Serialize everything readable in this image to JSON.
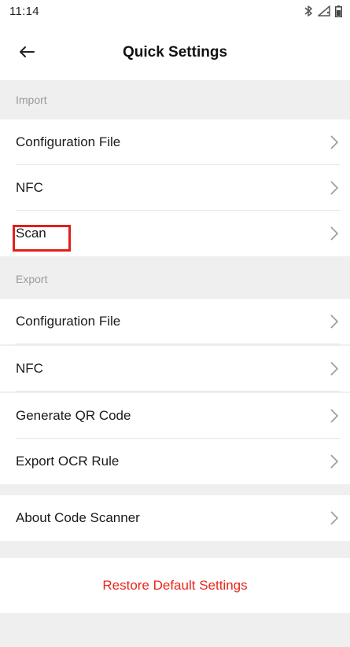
{
  "status_bar": {
    "time": "11:14",
    "icons": [
      "bluetooth-icon",
      "signal-icon",
      "battery-icon"
    ]
  },
  "app_bar": {
    "back_icon": "arrow-left-icon",
    "title": "Quick Settings"
  },
  "import_section": {
    "header": "Import",
    "items": [
      {
        "label": "Configuration File"
      },
      {
        "label": "NFC"
      },
      {
        "label": "Scan"
      }
    ]
  },
  "export_section": {
    "header": "Export",
    "items": [
      {
        "label": "Configuration File"
      },
      {
        "label": "NFC"
      },
      {
        "label": "Generate QR Code"
      },
      {
        "label": "Export OCR Rule"
      }
    ]
  },
  "about": {
    "label": "About Code Scanner"
  },
  "restore": {
    "label": "Restore Default Settings"
  },
  "colors": {
    "accent_red": "#e8271c",
    "highlight_border": "#e0201b",
    "section_bg": "#efefef"
  }
}
